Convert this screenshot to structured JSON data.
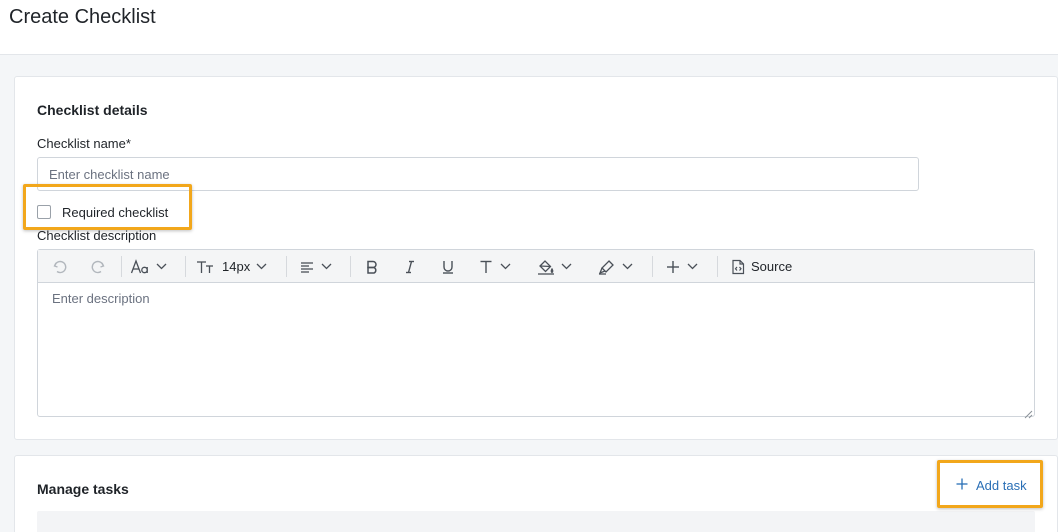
{
  "page": {
    "title": "Create Checklist"
  },
  "details": {
    "section_title": "Checklist details",
    "name_label": "Checklist name*",
    "name_placeholder": "Enter checklist name",
    "name_value": "",
    "required_label": "Required checklist",
    "required_checked": false,
    "description_label": "Checklist description",
    "description_placeholder": "Enter description"
  },
  "toolbar": {
    "undo_icon": "undo-icon",
    "redo_icon": "redo-icon",
    "font_family_icon": "font-family-icon",
    "font_size_icon": "font-size-icon",
    "font_size_value": "14px",
    "align_icon": "align-icon",
    "bold_icon": "bold-icon",
    "italic_icon": "italic-icon",
    "underline_icon": "underline-icon",
    "text_style_icon": "text-style-icon",
    "fill_color_icon": "fill-color-icon",
    "highlight_icon": "highlighter-icon",
    "insert_icon": "plus-icon",
    "source_label": "Source"
  },
  "tasks": {
    "section_title": "Manage tasks",
    "add_task_label": "Add task"
  },
  "colors": {
    "accent": "#2a6fb6",
    "highlight_border": "#f2a71b",
    "background": "#f4f6f8"
  }
}
